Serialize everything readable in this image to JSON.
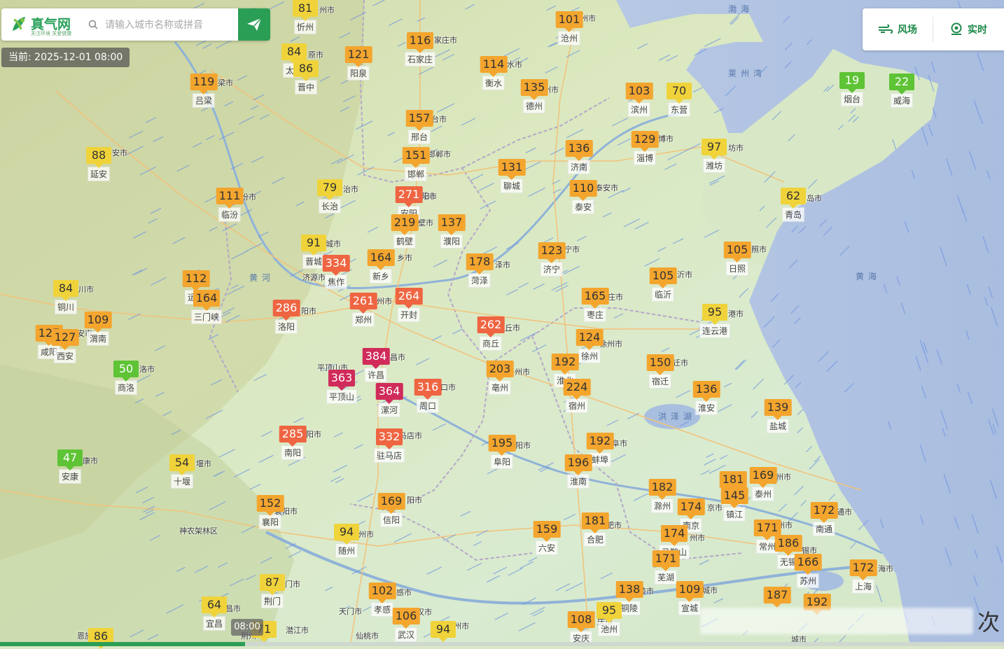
{
  "app": {
    "logo_name": "真气网",
    "logo_slogan": "关注环境 关爱健康",
    "search_placeholder": "请输入城市名称或拼音",
    "current_time": "当前: 2025-12-01 08:00",
    "btn_wind": "风场",
    "btn_realtime": "实时",
    "timeline_label": "08:00",
    "corner_char": "次"
  },
  "colors": {
    "good": "#5ec335",
    "moderate": "#f0d33a",
    "light": "#f3a52e",
    "medium": "#ef6542",
    "heavy": "#d02b5a",
    "accent": "#2b9e56"
  },
  "stations": [
    {
      "aqi": "81",
      "name": "忻州",
      "lvl": "moderate"
    },
    {
      "aqi": "116",
      "name": "石家庄",
      "lvl": "light"
    },
    {
      "aqi": "101",
      "name": "沧州",
      "lvl": "light"
    },
    {
      "aqi": "84",
      "name": "太原",
      "lvl": "moderate"
    },
    {
      "aqi": "86",
      "name": "晋中",
      "lvl": "moderate"
    },
    {
      "aqi": "121",
      "name": "阳泉",
      "lvl": "light"
    },
    {
      "aqi": "119",
      "name": "吕梁",
      "lvl": "light"
    },
    {
      "aqi": "114",
      "name": "衡水",
      "lvl": "light"
    },
    {
      "aqi": "135",
      "name": "德州",
      "lvl": "light"
    },
    {
      "aqi": "103",
      "name": "滨州",
      "lvl": "light"
    },
    {
      "aqi": "70",
      "name": "东营",
      "lvl": "moderate"
    },
    {
      "aqi": "19",
      "name": "烟台",
      "lvl": "good"
    },
    {
      "aqi": "22",
      "name": "威海",
      "lvl": "good"
    },
    {
      "aqi": "157",
      "name": "邢台",
      "lvl": "light"
    },
    {
      "aqi": "88",
      "name": "延安",
      "lvl": "moderate"
    },
    {
      "aqi": "151",
      "name": "邯郸",
      "lvl": "light"
    },
    {
      "aqi": "136",
      "name": "济南",
      "lvl": "light"
    },
    {
      "aqi": "129",
      "name": "淄博",
      "lvl": "light"
    },
    {
      "aqi": "97",
      "name": "潍坊",
      "lvl": "moderate"
    },
    {
      "aqi": "131",
      "name": "聊城",
      "lvl": "light"
    },
    {
      "aqi": "111",
      "name": "临汾",
      "lvl": "light"
    },
    {
      "aqi": "79",
      "name": "长治",
      "lvl": "moderate"
    },
    {
      "aqi": "271",
      "name": "安阳",
      "lvl": "medium"
    },
    {
      "aqi": "110",
      "name": "泰安",
      "lvl": "light"
    },
    {
      "aqi": "62",
      "name": "青岛",
      "lvl": "moderate"
    },
    {
      "aqi": "219",
      "name": "鹤壁",
      "lvl": "light"
    },
    {
      "aqi": "137",
      "name": "濮阳",
      "lvl": "light"
    },
    {
      "aqi": "91",
      "name": "晋城",
      "lvl": "moderate"
    },
    {
      "aqi": "334",
      "name": "焦作",
      "lvl": "medium"
    },
    {
      "aqi": "164",
      "name": "新乡",
      "lvl": "light"
    },
    {
      "aqi": "178",
      "name": "菏泽",
      "lvl": "light"
    },
    {
      "aqi": "123",
      "name": "济宁",
      "lvl": "light"
    },
    {
      "aqi": "105",
      "name": "日照",
      "lvl": "light"
    },
    {
      "aqi": "84",
      "name": "铜川",
      "lvl": "moderate"
    },
    {
      "aqi": "112",
      "name": "运城",
      "lvl": "light"
    },
    {
      "aqi": "164",
      "name": "三门峡",
      "lvl": "light"
    },
    {
      "aqi": "286",
      "name": "洛阳",
      "lvl": "medium"
    },
    {
      "aqi": "261",
      "name": "郑州",
      "lvl": "medium"
    },
    {
      "aqi": "264",
      "name": "开封",
      "lvl": "medium"
    },
    {
      "aqi": "105",
      "name": "临沂",
      "lvl": "light"
    },
    {
      "aqi": "165",
      "name": "枣庄",
      "lvl": "light"
    },
    {
      "aqi": "95",
      "name": "连云港",
      "lvl": "moderate"
    },
    {
      "aqi": "109",
      "name": "渭南",
      "lvl": "light"
    },
    {
      "aqi": "127",
      "name": "咸阳",
      "lvl": "light"
    },
    {
      "aqi": "127",
      "name": "西安",
      "lvl": "light"
    },
    {
      "aqi": "262",
      "name": "商丘",
      "lvl": "medium"
    },
    {
      "aqi": "124",
      "name": "徐州",
      "lvl": "light"
    },
    {
      "aqi": "50",
      "name": "商洛",
      "lvl": "good"
    },
    {
      "aqi": "384",
      "name": "许昌",
      "lvl": "heavy"
    },
    {
      "aqi": "363",
      "name": "平顶山",
      "lvl": "heavy"
    },
    {
      "aqi": "364",
      "name": "漯河",
      "lvl": "heavy"
    },
    {
      "aqi": "316",
      "name": "周口",
      "lvl": "medium"
    },
    {
      "aqi": "203",
      "name": "亳州",
      "lvl": "light"
    },
    {
      "aqi": "192",
      "name": "淮北",
      "lvl": "light"
    },
    {
      "aqi": "224",
      "name": "宿州",
      "lvl": "light"
    },
    {
      "aqi": "150",
      "name": "宿迁",
      "lvl": "light"
    },
    {
      "aqi": "136",
      "name": "淮安",
      "lvl": "light"
    },
    {
      "aqi": "139",
      "name": "盐城",
      "lvl": "light"
    },
    {
      "aqi": "285",
      "name": "南阳",
      "lvl": "medium"
    },
    {
      "aqi": "332",
      "name": "驻马店",
      "lvl": "medium"
    },
    {
      "aqi": "47",
      "name": "安康",
      "lvl": "good"
    },
    {
      "aqi": "54",
      "name": "十堰",
      "lvl": "moderate"
    },
    {
      "aqi": "195",
      "name": "阜阳",
      "lvl": "light"
    },
    {
      "aqi": "192",
      "name": "蚌埠",
      "lvl": "light"
    },
    {
      "aqi": "196",
      "name": "淮南",
      "lvl": "light"
    },
    {
      "aqi": "181",
      "name": "扬州",
      "lvl": "light"
    },
    {
      "aqi": "169",
      "name": "泰州",
      "lvl": "light"
    },
    {
      "aqi": "152",
      "name": "襄阳",
      "lvl": "light"
    },
    {
      "aqi": "169",
      "name": "信阳",
      "lvl": "light"
    },
    {
      "aqi": "182",
      "name": "滁州",
      "lvl": "light"
    },
    {
      "aqi": "174",
      "name": "南京",
      "lvl": "light"
    },
    {
      "aqi": "145",
      "name": "镇江",
      "lvl": "light"
    },
    {
      "aqi": "172",
      "name": "南通",
      "lvl": "light"
    },
    {
      "aqi": "94",
      "name": "随州",
      "lvl": "moderate"
    },
    {
      "aqi": "159",
      "name": "六安",
      "lvl": "light"
    },
    {
      "aqi": "181",
      "name": "合肥",
      "lvl": "light"
    },
    {
      "aqi": "174",
      "name": "马鞍山",
      "lvl": "light"
    },
    {
      "aqi": "171",
      "name": "常州",
      "lvl": "light"
    },
    {
      "aqi": "186",
      "name": "无锡",
      "lvl": "light"
    },
    {
      "aqi": "166",
      "name": "苏州",
      "lvl": "light"
    },
    {
      "aqi": "171",
      "name": "芜湖",
      "lvl": "light"
    },
    {
      "aqi": "172",
      "name": "上海",
      "lvl": "light"
    },
    {
      "aqi": "87",
      "name": "荆门",
      "lvl": "moderate"
    },
    {
      "aqi": "138",
      "name": "铜陵",
      "lvl": "light"
    },
    {
      "aqi": "109",
      "name": "宣城",
      "lvl": "light"
    },
    {
      "aqi": "187",
      "name": "",
      "lvl": "light"
    },
    {
      "aqi": "192",
      "name": "",
      "lvl": "light"
    },
    {
      "aqi": "102",
      "name": "孝感",
      "lvl": "light"
    },
    {
      "aqi": "64",
      "name": "宜昌",
      "lvl": "moderate"
    },
    {
      "aqi": "106",
      "name": "武汉",
      "lvl": "light"
    },
    {
      "aqi": "95",
      "name": "池州",
      "lvl": "moderate"
    },
    {
      "aqi": "108",
      "name": "安庆",
      "lvl": "light"
    },
    {
      "aqi": "94",
      "name": "",
      "lvl": "moderate"
    },
    {
      "aqi": "86",
      "name": "",
      "lvl": "moderate"
    },
    {
      "aqi": "71",
      "name": "",
      "lvl": "moderate"
    }
  ],
  "base_labels": [
    "州市",
    "家庄市",
    "州市",
    "原市",
    "梁市",
    "水市",
    "州市",
    "台市",
    "邯郸市",
    "博市",
    "坊市",
    "岛市",
    "安市",
    "治市",
    "城市",
    "泰安市",
    "汾市",
    "阳市",
    "壁市",
    "宁市",
    "照市",
    "济源市",
    "乡市",
    "泽市",
    "城市",
    "沂市",
    "州市",
    "阳市",
    "川市",
    "庄市",
    "港市",
    "安市",
    "丘市",
    "徐州市",
    "洛市",
    "昌市",
    "平顶山市",
    "口市",
    "州市",
    "迁市",
    "阳市",
    "马店市",
    "康市",
    "堰市",
    "阳市",
    "阜市",
    "州市",
    "京市",
    "通市",
    "州市",
    "襄阳市",
    "阳市",
    "神农架林区",
    "州市",
    "肥市",
    "锡市",
    "州市",
    "城市",
    "海市",
    "门市",
    "天门市",
    "感市",
    "汉市",
    "陵市",
    "昌市",
    "潜江市",
    "仙桃市",
    "州市",
    "庆市",
    "恩施",
    "荆州",
    "城市"
  ],
  "water_labels": [
    "莱州湾",
    "洪泽湖",
    "黄海",
    "渤海",
    "黄河"
  ]
}
